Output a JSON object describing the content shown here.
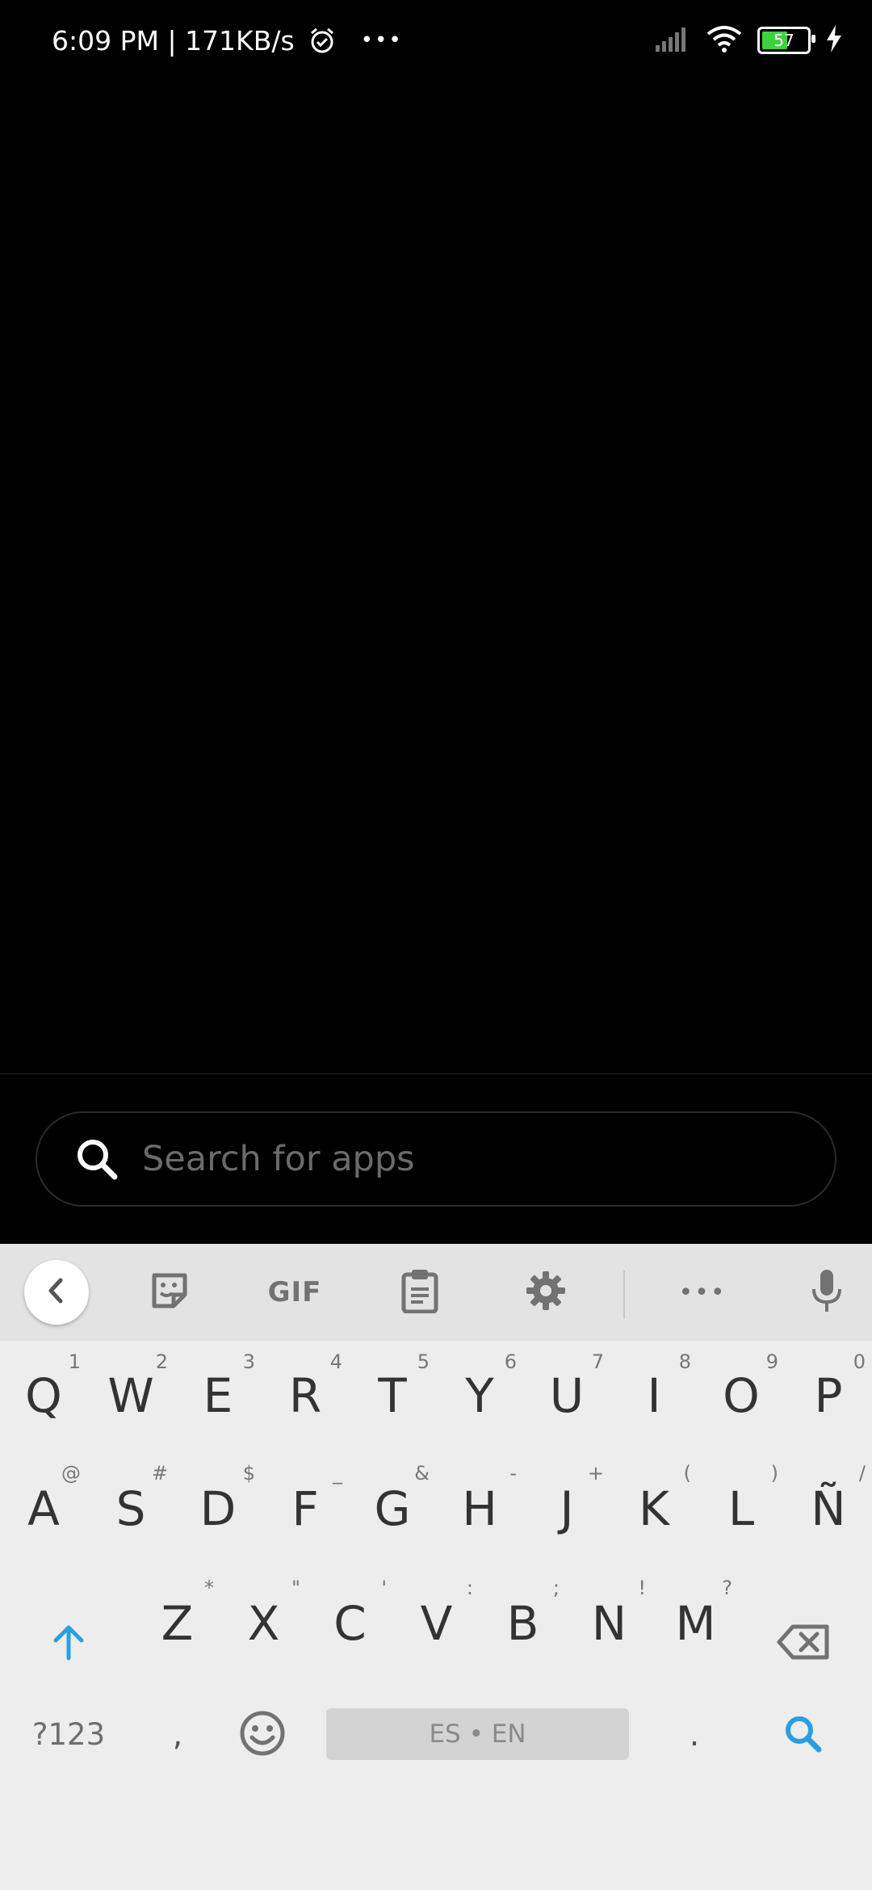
{
  "status_bar": {
    "time_speed": "6:09 PM | 171KB/s",
    "overflow": "•••",
    "battery": "57",
    "battery_level_percent": 57
  },
  "search": {
    "placeholder": "Search for apps"
  },
  "keyboard": {
    "toolbar": {
      "gif_label": "GIF",
      "more": "•••"
    },
    "rows": [
      [
        {
          "main": "Q",
          "hint": "1"
        },
        {
          "main": "W",
          "hint": "2"
        },
        {
          "main": "E",
          "hint": "3"
        },
        {
          "main": "R",
          "hint": "4"
        },
        {
          "main": "T",
          "hint": "5"
        },
        {
          "main": "Y",
          "hint": "6"
        },
        {
          "main": "U",
          "hint": "7"
        },
        {
          "main": "I",
          "hint": "8"
        },
        {
          "main": "O",
          "hint": "9"
        },
        {
          "main": "P",
          "hint": "0"
        }
      ],
      [
        {
          "main": "A",
          "hint": "@"
        },
        {
          "main": "S",
          "hint": "#"
        },
        {
          "main": "D",
          "hint": "$"
        },
        {
          "main": "F",
          "hint": "_"
        },
        {
          "main": "G",
          "hint": "&"
        },
        {
          "main": "H",
          "hint": "-"
        },
        {
          "main": "J",
          "hint": "+"
        },
        {
          "main": "K",
          "hint": "("
        },
        {
          "main": "L",
          "hint": ")"
        },
        {
          "main": "Ñ",
          "hint": "/"
        }
      ],
      [
        {
          "main": "Z",
          "hint": "*"
        },
        {
          "main": "X",
          "hint": "\""
        },
        {
          "main": "C",
          "hint": "'"
        },
        {
          "main": "V",
          "hint": ":"
        },
        {
          "main": "B",
          "hint": ";"
        },
        {
          "main": "N",
          "hint": "!"
        },
        {
          "main": "M",
          "hint": "?"
        }
      ]
    ],
    "bottom": {
      "symbols": "?123",
      "comma": ",",
      "space": "ES • EN",
      "period": "."
    },
    "colors": {
      "accent": "#2a9fe0",
      "key_text": "#333333",
      "icon": "#727272"
    }
  }
}
